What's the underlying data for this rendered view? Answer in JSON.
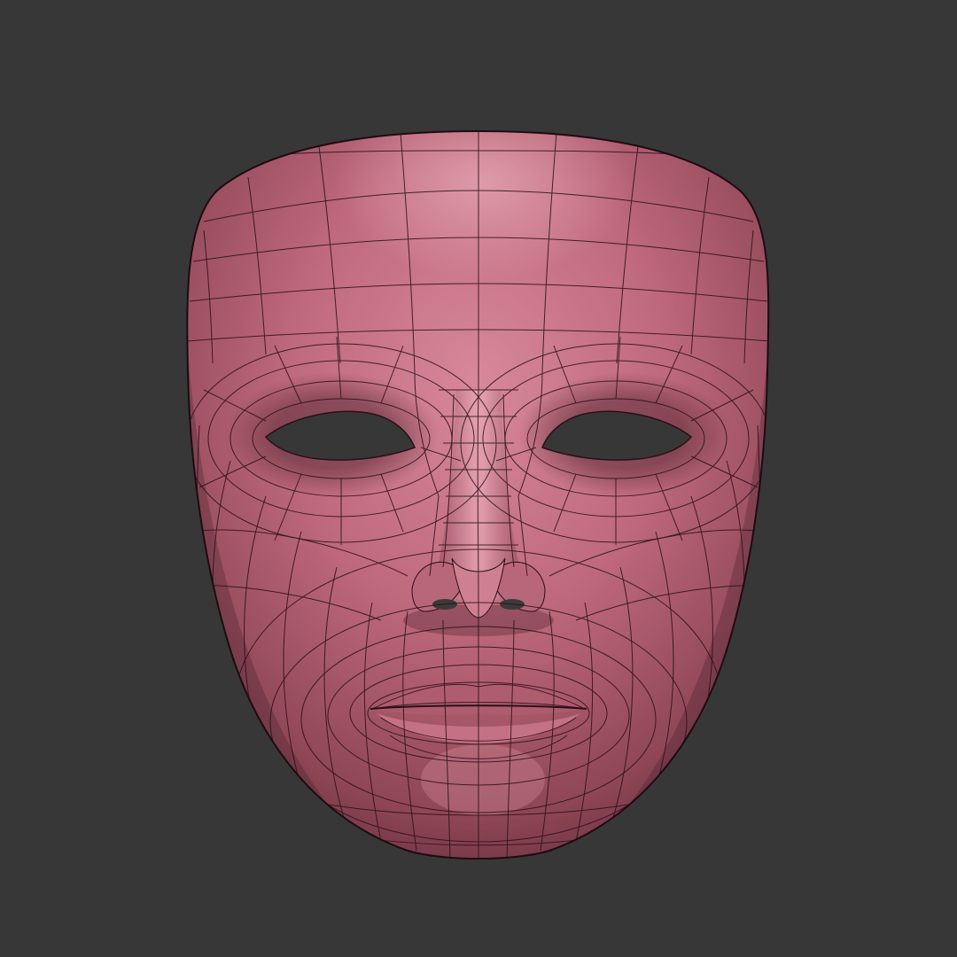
{
  "viewport": {
    "background_color": "#373737"
  },
  "model": {
    "name": "face-mask",
    "display_mode": "wireframe-on-shaded",
    "surface_color": "#c06a7d",
    "highlight_color": "#dd9aaa",
    "shadow_color": "#5a2c38",
    "wire_color": "#2a1018"
  }
}
